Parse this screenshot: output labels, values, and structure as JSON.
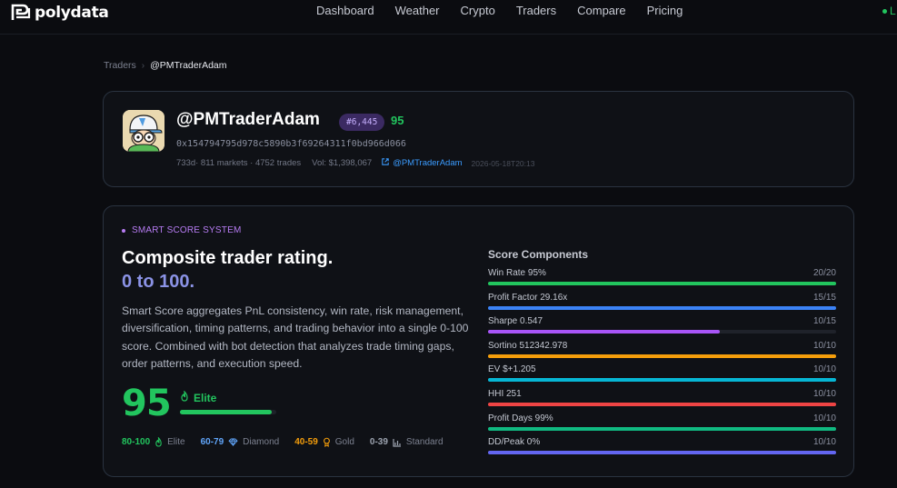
{
  "nav": {
    "brand": "polydata",
    "links": [
      "Dashboard",
      "Weather",
      "Crypto",
      "Traders",
      "Compare",
      "Pricing"
    ],
    "status": "L"
  },
  "breadcrumb": {
    "parent": "Traders",
    "separator": "›",
    "current": "@PMTraderAdam"
  },
  "profile": {
    "handle": "@PMTraderAdam",
    "rank": "#6,445",
    "score": "95",
    "address": "0x154794795d978c5890b3f69264311f0bd966d066",
    "age_markets": "733d· 811 markets",
    "trades": "· 4752 trades",
    "volume": "Vol: $1,398,067",
    "link_label": "@PMTraderAdam",
    "timestamp": "2026-05-18T20:13"
  },
  "smart_score": {
    "tag": "SMART SCORE SYSTEM",
    "headline": "Composite trader rating.",
    "subheadline": "0 to 100.",
    "description": "Smart Score aggregates PnL consistency, win rate, risk management, diversification, timing patterns, and trading behavior into a single 0-100 score. Combined with bot detection that analyzes trade timing gaps, order patterns, and execution speed.",
    "score": "95",
    "score_fraction": 0.95,
    "tier_label": "Elite",
    "tiers": [
      {
        "range": "80-100",
        "name": "Elite",
        "color": "#22c55e",
        "icon": "flame-icon"
      },
      {
        "range": "60-79",
        "name": "Diamond",
        "color": "#60a5fa",
        "icon": "diamond-icon"
      },
      {
        "range": "40-59",
        "name": "Gold",
        "color": "#f59e0b",
        "icon": "medal-icon"
      },
      {
        "range": "0-39",
        "name": "Standard",
        "color": "#9ca3af",
        "icon": "bar-chart-icon"
      }
    ]
  },
  "components": {
    "title": "Score Components",
    "items": [
      {
        "label": "Win Rate 95%",
        "value": "20/20",
        "fraction": 1.0,
        "color": "#22c55e"
      },
      {
        "label": "Profit Factor 29.16x",
        "value": "15/15",
        "fraction": 1.0,
        "color": "#3b82f6"
      },
      {
        "label": "Sharpe 0.547",
        "value": "10/15",
        "fraction": 0.667,
        "color": "#a855f7"
      },
      {
        "label": "Sortino 512342.978",
        "value": "10/10",
        "fraction": 1.0,
        "color": "#f59e0b"
      },
      {
        "label": "EV $+1.205",
        "value": "10/10",
        "fraction": 1.0,
        "color": "#06b6d4"
      },
      {
        "label": "HHI 251",
        "value": "10/10",
        "fraction": 1.0,
        "color": "#ef4444"
      },
      {
        "label": "Profit Days 99%",
        "value": "10/10",
        "fraction": 1.0,
        "color": "#10b981"
      },
      {
        "label": "DD/Peak 0%",
        "value": "10/10",
        "fraction": 1.0,
        "color": "#6366f1"
      }
    ]
  }
}
